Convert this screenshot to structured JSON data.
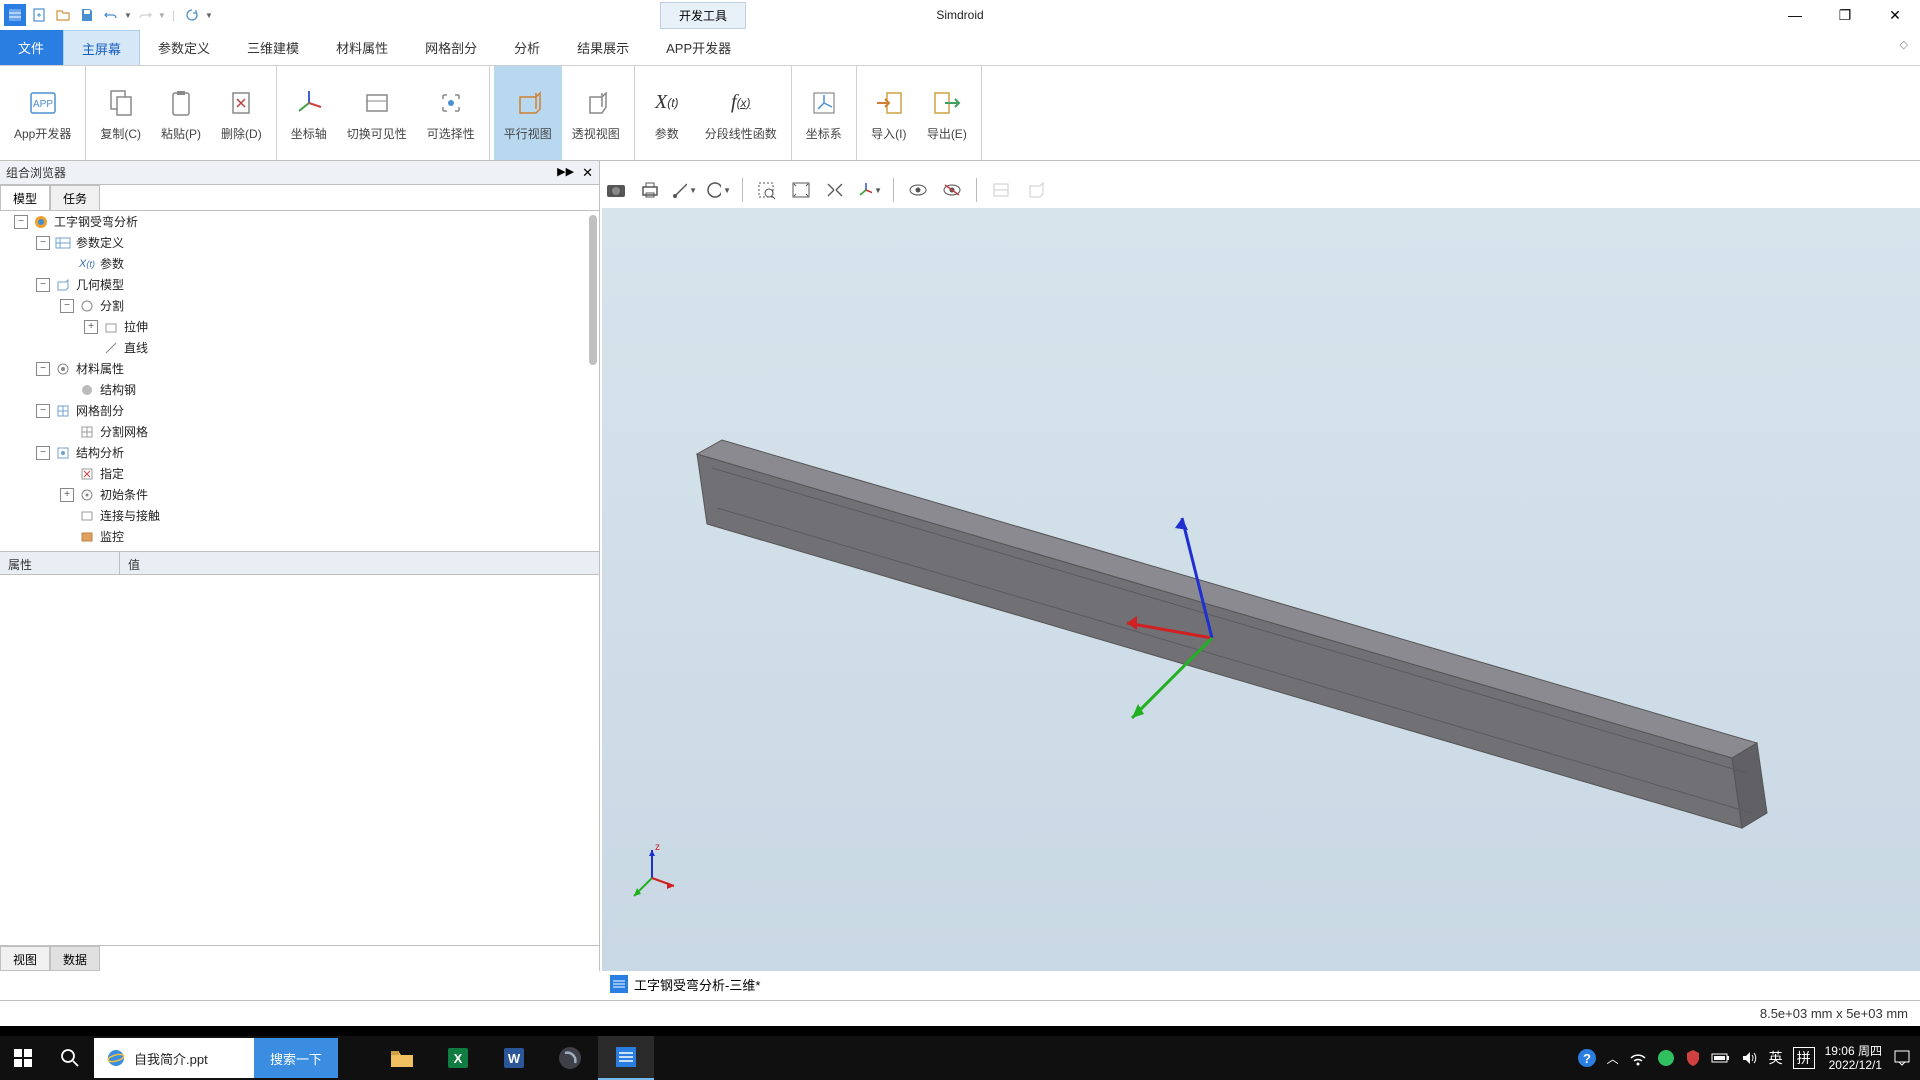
{
  "titlebar": {
    "dev_tools_tab": "开发工具",
    "app_name": "Simdroid"
  },
  "menu": {
    "file": "文件",
    "tabs": [
      "主屏幕",
      "参数定义",
      "三维建模",
      "材料属性",
      "网格剖分",
      "分析",
      "结果展示",
      "APP开发器"
    ],
    "active_index": 0
  },
  "ribbon": {
    "groups": [
      {
        "items": [
          {
            "label": "App开发器",
            "icon": "app"
          }
        ]
      },
      {
        "items": [
          {
            "label": "复制(C)",
            "icon": "copy"
          },
          {
            "label": "粘贴(P)",
            "icon": "paste"
          },
          {
            "label": "删除(D)",
            "icon": "delete"
          }
        ]
      },
      {
        "items": [
          {
            "label": "坐标轴",
            "icon": "axis"
          },
          {
            "label": "切换可见性",
            "icon": "visibility"
          },
          {
            "label": "可选择性",
            "icon": "selectable"
          }
        ]
      },
      {
        "items": [
          {
            "label": "平行视图",
            "icon": "parallel",
            "active": true
          },
          {
            "label": "透视视图",
            "icon": "perspective"
          }
        ]
      },
      {
        "items": [
          {
            "label": "参数",
            "icon": "param"
          },
          {
            "label": "分段线性函数",
            "icon": "piecewise"
          }
        ]
      },
      {
        "items": [
          {
            "label": "坐标系",
            "icon": "coordsys"
          }
        ]
      },
      {
        "items": [
          {
            "label": "导入(I)",
            "icon": "import"
          },
          {
            "label": "导出(E)",
            "icon": "export"
          }
        ]
      }
    ]
  },
  "browser": {
    "title": "组合浏览器",
    "tabs": {
      "model": "模型",
      "task": "任务"
    },
    "tree": [
      {
        "level": 1,
        "toggle": "−",
        "icon": "proj",
        "label": "工字钢受弯分析"
      },
      {
        "level": 2,
        "toggle": "−",
        "icon": "params",
        "label": "参数定义"
      },
      {
        "level": 3,
        "toggle": "",
        "icon": "xt",
        "label": "参数"
      },
      {
        "level": 2,
        "toggle": "−",
        "icon": "geom",
        "label": "几何模型"
      },
      {
        "level": 3,
        "toggle": "−",
        "icon": "folder",
        "label": "分割"
      },
      {
        "level": 4,
        "toggle": "+",
        "icon": "extrude",
        "label": "拉伸"
      },
      {
        "level": 4,
        "toggle": "",
        "icon": "line",
        "label": "直线"
      },
      {
        "level": 2,
        "toggle": "−",
        "icon": "material",
        "label": "材料属性"
      },
      {
        "level": 3,
        "toggle": "",
        "icon": "steel",
        "label": "结构钢"
      },
      {
        "level": 2,
        "toggle": "−",
        "icon": "mesh",
        "label": "网格剖分"
      },
      {
        "level": 3,
        "toggle": "",
        "icon": "meshpart",
        "label": "分割网格"
      },
      {
        "level": 2,
        "toggle": "−",
        "icon": "analysis",
        "label": "结构分析"
      },
      {
        "level": 3,
        "toggle": "",
        "icon": "assign",
        "label": "指定"
      },
      {
        "level": 3,
        "toggle": "+",
        "icon": "initial",
        "label": "初始条件"
      },
      {
        "level": 3,
        "toggle": "",
        "icon": "contact",
        "label": "连接与接触"
      },
      {
        "level": 3,
        "toggle": "",
        "icon": "monitor",
        "label": "监控"
      }
    ],
    "prop_cols": {
      "attr": "属性",
      "value": "值"
    },
    "bottom_tabs": {
      "view": "视图",
      "data": "数据"
    }
  },
  "viewport": {
    "doc_title": "工字钢受弯分析-三维*"
  },
  "statusbar": {
    "dims": "8.5e+03 mm x 5e+03 mm"
  },
  "taskbar": {
    "search_doc": "自我简介.ppt",
    "search_btn": "搜索一下",
    "ime_lang": "英",
    "ime_mode": "拼",
    "clock_time": "19:06",
    "clock_day": "周四",
    "clock_date": "2022/12/1"
  }
}
